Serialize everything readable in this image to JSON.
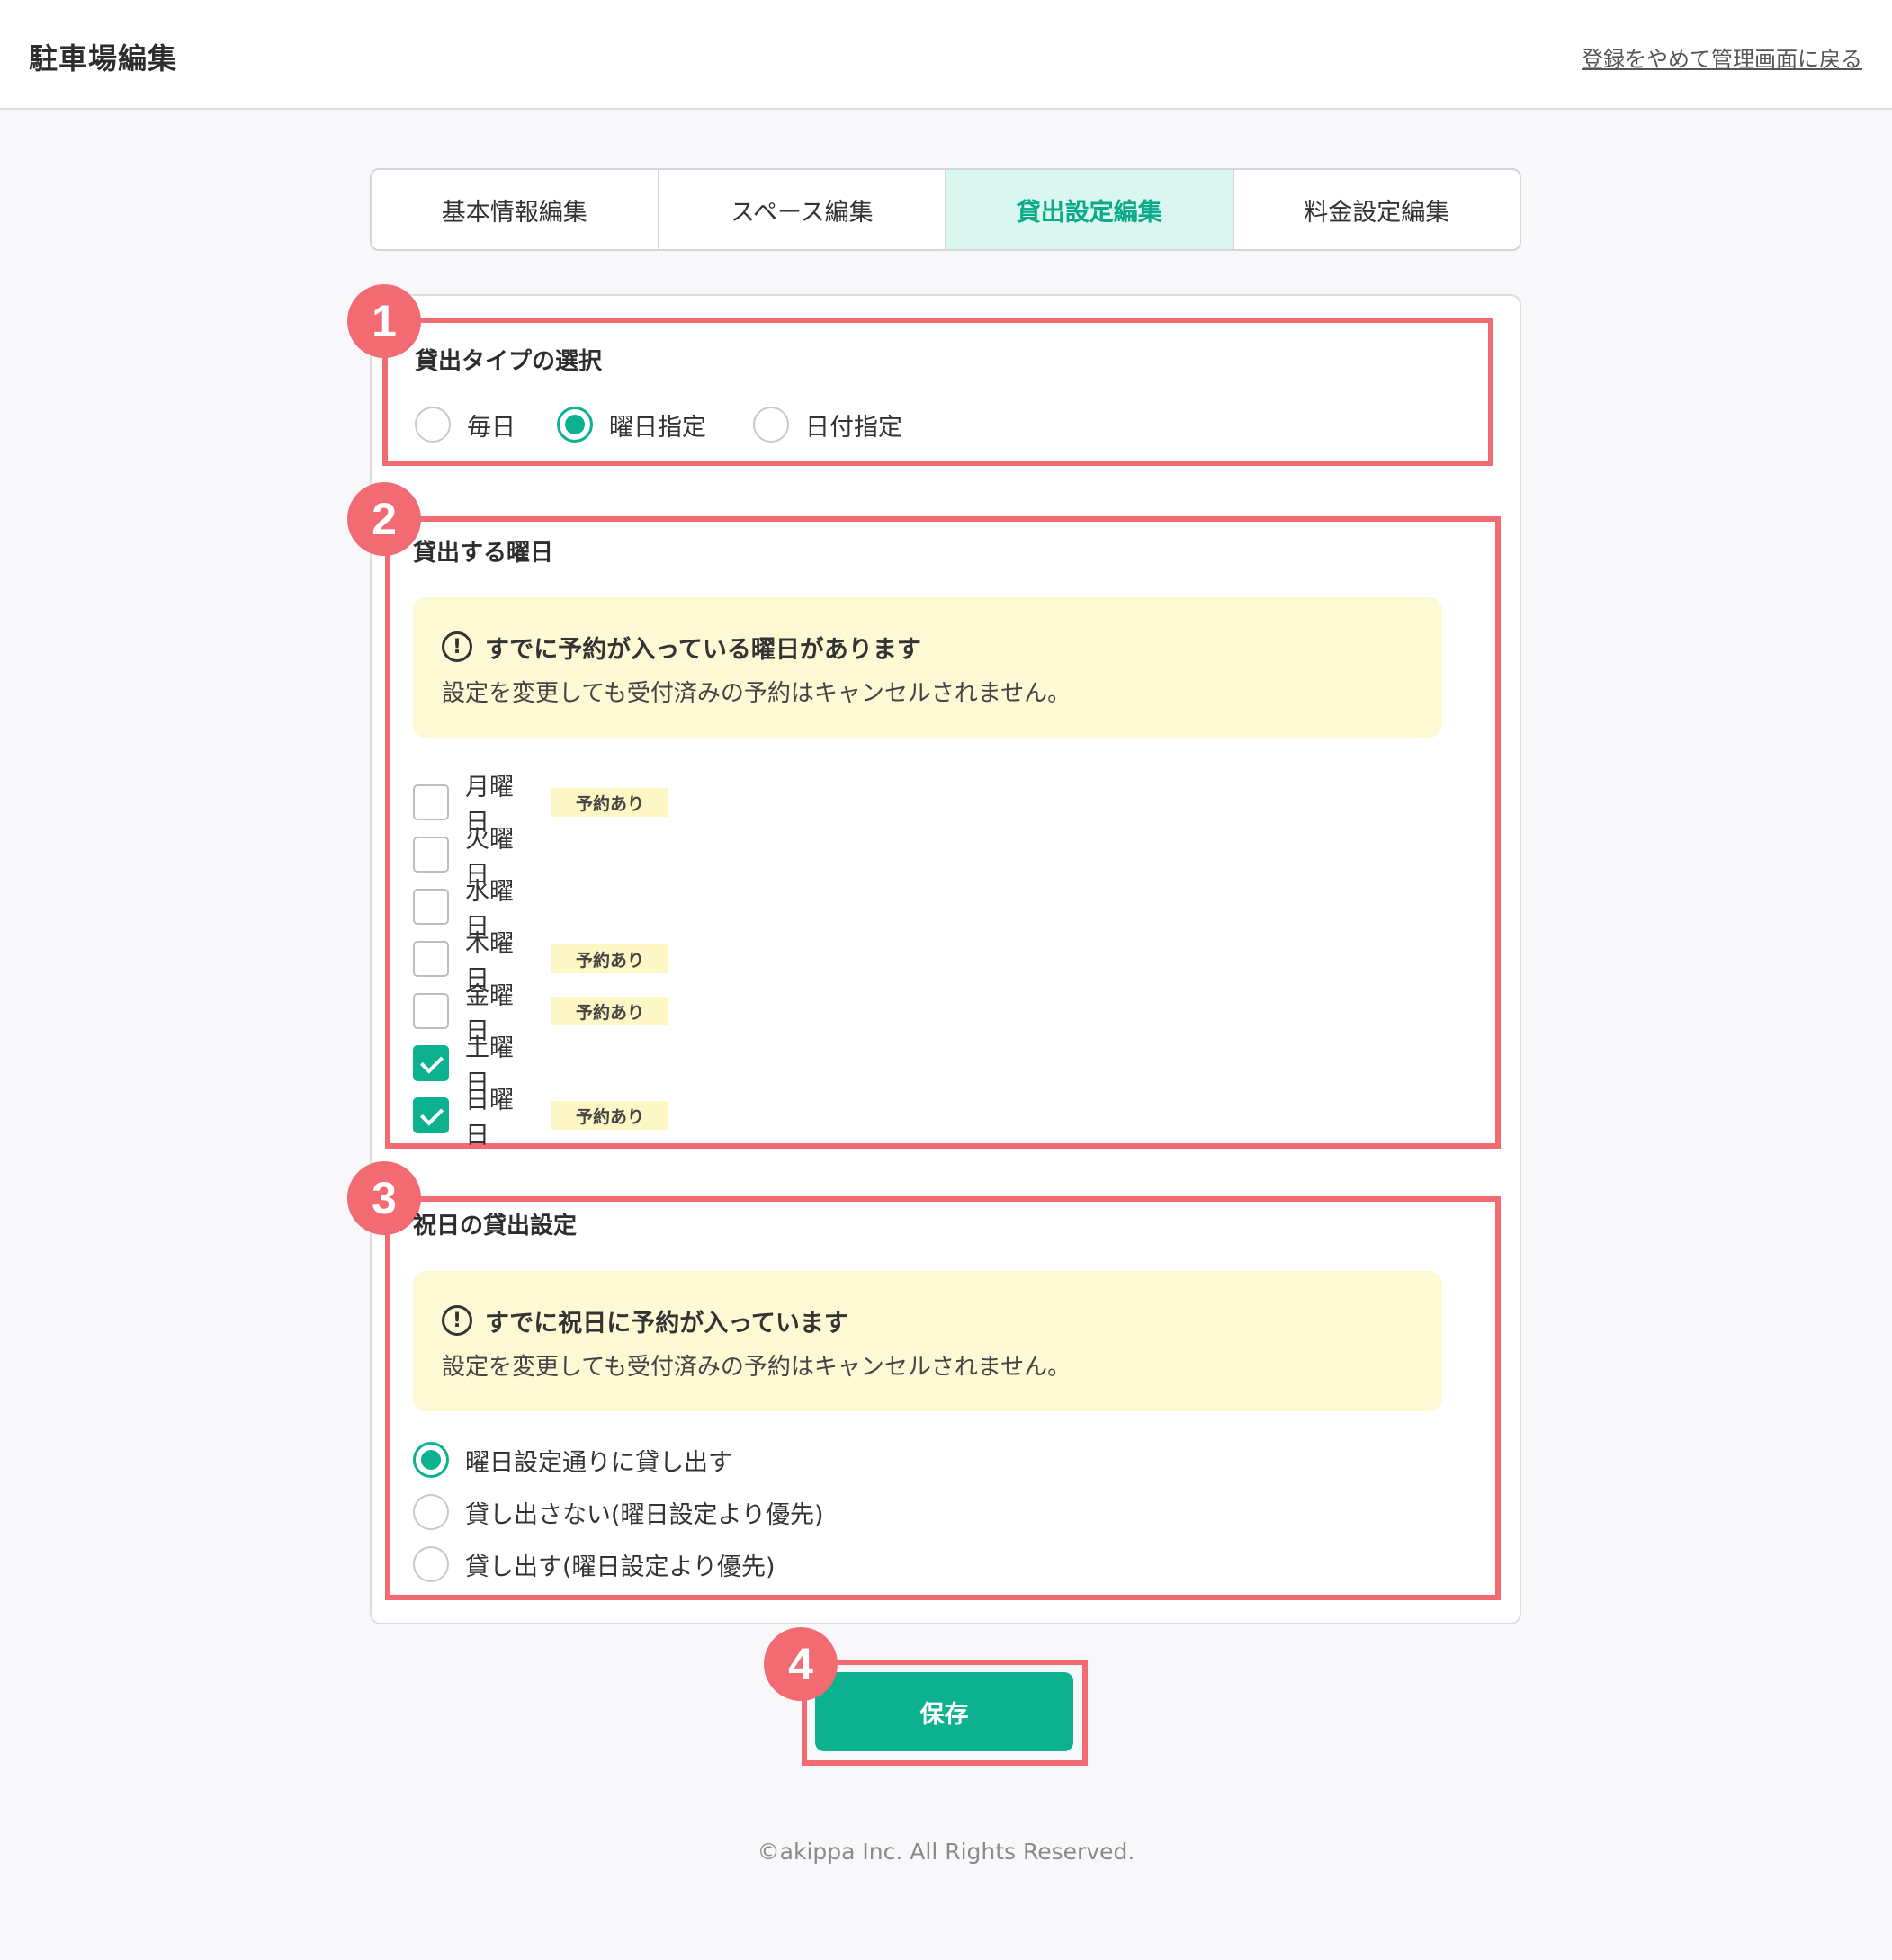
{
  "header": {
    "title": "駐車場編集",
    "back_link": "登録をやめて管理画面に戻る"
  },
  "tabs": [
    {
      "label": "基本情報編集",
      "active": false
    },
    {
      "label": "スペース編集",
      "active": false
    },
    {
      "label": "貸出設定編集",
      "active": true
    },
    {
      "label": "料金設定編集",
      "active": false
    }
  ],
  "annotations": [
    "1",
    "2",
    "3",
    "4"
  ],
  "rental_type": {
    "title": "貸出タイプの選択",
    "options": [
      {
        "label": "毎日",
        "selected": false
      },
      {
        "label": "曜日指定",
        "selected": true
      },
      {
        "label": "日付指定",
        "selected": false
      }
    ]
  },
  "weekdays": {
    "title": "貸出する曜日",
    "notice_icon": "exclamation-circle-icon",
    "notice_title": "すでに予約が入っている曜日があります",
    "notice_text": "設定を変更しても受付済みの予約はキャンセルされません。",
    "reserved_label": "予約あり",
    "days": [
      {
        "label": "月曜日",
        "checked": false,
        "reserved": true
      },
      {
        "label": "火曜日",
        "checked": false,
        "reserved": false
      },
      {
        "label": "水曜日",
        "checked": false,
        "reserved": false
      },
      {
        "label": "木曜日",
        "checked": false,
        "reserved": true
      },
      {
        "label": "金曜日",
        "checked": false,
        "reserved": true
      },
      {
        "label": "土曜日",
        "checked": true,
        "reserved": false
      },
      {
        "label": "日曜日",
        "checked": true,
        "reserved": true
      }
    ]
  },
  "holiday": {
    "title": "祝日の貸出設定",
    "notice_title": "すでに祝日に予約が入っています",
    "notice_text": "設定を変更しても受付済みの予約はキャンセルされません。",
    "options": [
      {
        "label": "曜日設定通りに貸し出す",
        "selected": true
      },
      {
        "label": "貸し出さない(曜日設定より優先)",
        "selected": false
      },
      {
        "label": "貸し出す(曜日設定より優先)",
        "selected": false
      }
    ]
  },
  "save_label": "保存",
  "footer": "©akippa Inc. All Rights Reserved.",
  "colors": {
    "accent": "#0cb28f",
    "highlight": "#f26a72",
    "notice_bg": "#fdf9d4"
  }
}
